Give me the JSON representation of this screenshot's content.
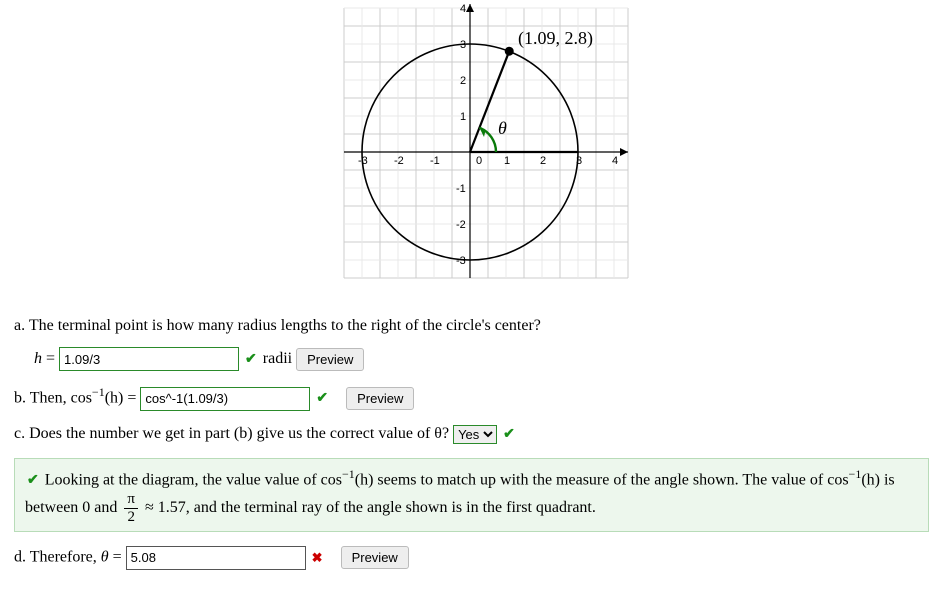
{
  "chart_data": {
    "type": "scatter",
    "title": "",
    "xlabel": "",
    "ylabel": "",
    "xlim": [
      -3.5,
      4.5
    ],
    "ylim": [
      -3.5,
      4.2
    ],
    "xticks": [
      -3,
      -2,
      -1,
      0,
      1,
      2,
      3,
      4
    ],
    "yticks": [
      -3,
      -2,
      -1,
      0,
      1,
      2,
      3,
      4
    ],
    "circle": {
      "cx": 0,
      "cy": 0,
      "r": 3
    },
    "terminal_point": {
      "x": 1.09,
      "y": 2.8
    },
    "point_label": "(1.09, 2.8)",
    "angle_label": "θ",
    "rays": [
      {
        "from": [
          0,
          0
        ],
        "to": [
          4.3,
          0
        ]
      },
      {
        "from": [
          0,
          0
        ],
        "to": [
          1.09,
          2.8
        ]
      }
    ]
  },
  "partA": {
    "prompt_pre": "a. The terminal point is how many radius lengths to the right of the circle's center?",
    "var": "h",
    "eq": " = ",
    "value": "1.09/3",
    "unit": " radii   ",
    "preview": "Preview"
  },
  "partB": {
    "prompt_pre": "b. Then, cos",
    "exp": "−1",
    "arg": "(h)",
    "eq": " = ",
    "value": "cos^-1(1.09/3)",
    "preview": "Preview"
  },
  "partC": {
    "prompt": "c. Does the number we get in part (b) give us the correct value of θ?",
    "selected": "Yes",
    "options": [
      "Yes",
      "No"
    ]
  },
  "feedback": {
    "pre": " Looking at the diagram, the value value of cos",
    "exp": "−1",
    "arg1": "(h)",
    "mid1": " seems to match up with the measure of the angle shown. The value of cos",
    "arg2": "(h)",
    "mid2": " is between 0 and ",
    "frac_num": "π",
    "frac_den": "2",
    "approx": " ≈ 1.57, and the terminal ray of the angle shown is in the first quadrant."
  },
  "partD": {
    "prompt_pre": "d. Therefore, ",
    "var": "θ",
    "eq": " = ",
    "value": "5.08",
    "preview": "Preview"
  }
}
